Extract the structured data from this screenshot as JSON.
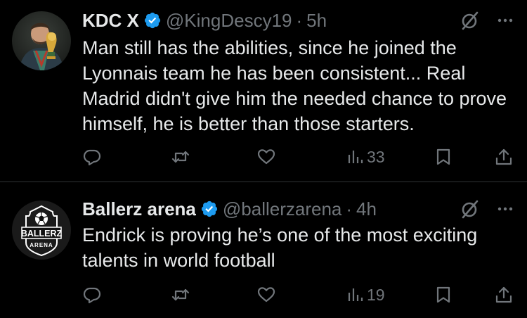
{
  "colors": {
    "background": "#000000",
    "text_primary": "#e7e9ea",
    "text_secondary": "#71767b",
    "verified_blue": "#1d9bf0",
    "divider": "#2f3336"
  },
  "tweets": [
    {
      "display_name": "KDC X",
      "handle": "@KingDescy19",
      "dot": "·",
      "time": "5h",
      "verified_icon": "verified-badge-icon",
      "text": "Man still has the abilities, since he joined the Lyonnais team he has been consistent... Real Madrid didn't give him the needed chance to prove himself, he is better than those starters.",
      "views": "33"
    },
    {
      "display_name": "Ballerz arena",
      "handle": "@ballerzarena",
      "dot": "·",
      "time": "4h",
      "verified_icon": "verified-badge-icon",
      "avatar_logo": {
        "top": "BALLERZ",
        "bottom": "ARENA"
      },
      "text": "Endrick is proving he’s one of the most exciting talents in world football",
      "views": "19"
    }
  ],
  "icons": {
    "reply": "reply-icon",
    "retweet": "retweet-icon",
    "like": "heart-icon",
    "views": "views-chart-icon",
    "bookmark": "bookmark-icon",
    "share": "share-icon",
    "grok": "grok-icon",
    "more": "more-dots-icon"
  }
}
